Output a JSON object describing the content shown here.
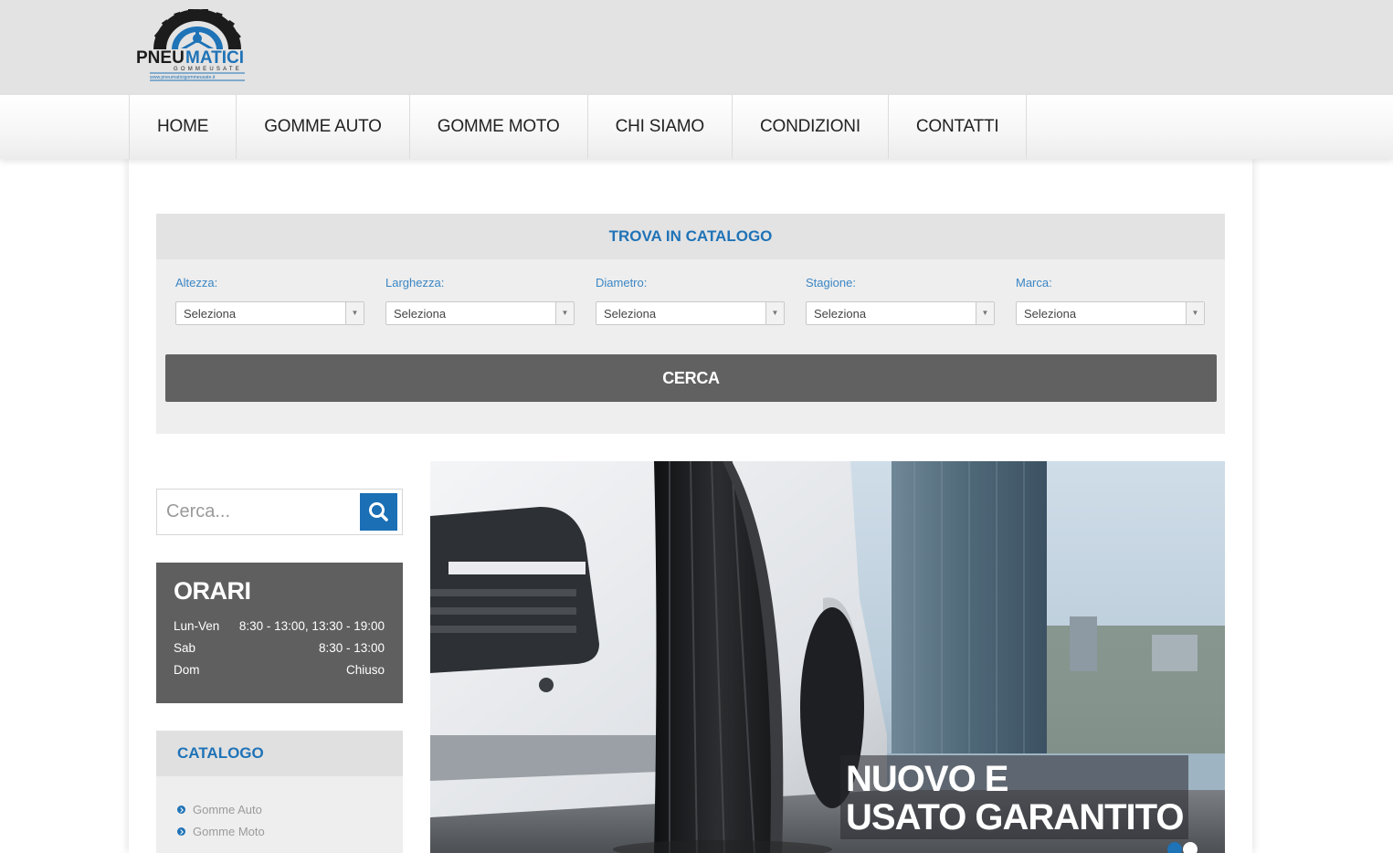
{
  "brand": {
    "logo_main_dark": "PNEU",
    "logo_main_blue": "MATICI",
    "logo_sub": "GOMMEUSATE",
    "logo_url": "www.pneumaticigommeusate.it",
    "colors": {
      "blue": "#1f73b7",
      "dark": "#1c1c1c"
    }
  },
  "nav": {
    "items": [
      {
        "label": "HOME"
      },
      {
        "label": "GOMME AUTO"
      },
      {
        "label": "GOMME MOTO"
      },
      {
        "label": "CHI SIAMO"
      },
      {
        "label": "CONDIZIONI"
      },
      {
        "label": "CONTATTI"
      }
    ]
  },
  "finder": {
    "title": "TROVA IN CATALOGO",
    "fields": [
      {
        "label": "Altezza:",
        "value": "Seleziona"
      },
      {
        "label": "Larghezza:",
        "value": "Seleziona"
      },
      {
        "label": "Diametro:",
        "value": "Seleziona"
      },
      {
        "label": "Stagione:",
        "value": "Seleziona"
      },
      {
        "label": "Marca:",
        "value": "Seleziona"
      }
    ],
    "button": "CERCA"
  },
  "search": {
    "placeholder": "Cerca..."
  },
  "orari": {
    "title": "ORARI",
    "rows": [
      {
        "day": "Lun-Ven",
        "hours": "8:30 - 13:00, 13:30 - 19:00"
      },
      {
        "day": "Sab",
        "hours": "8:30 - 13:00"
      },
      {
        "day": "Dom",
        "hours": "Chiuso"
      }
    ]
  },
  "catalogo": {
    "title": "CATALOGO",
    "items": [
      {
        "label": "Gomme Auto"
      },
      {
        "label": "Gomme Moto"
      }
    ]
  },
  "slider": {
    "caption_line1": "NUOVO E",
    "caption_line2": "USATO GARANTITO",
    "active_slide": 1,
    "slide_count": 2
  }
}
